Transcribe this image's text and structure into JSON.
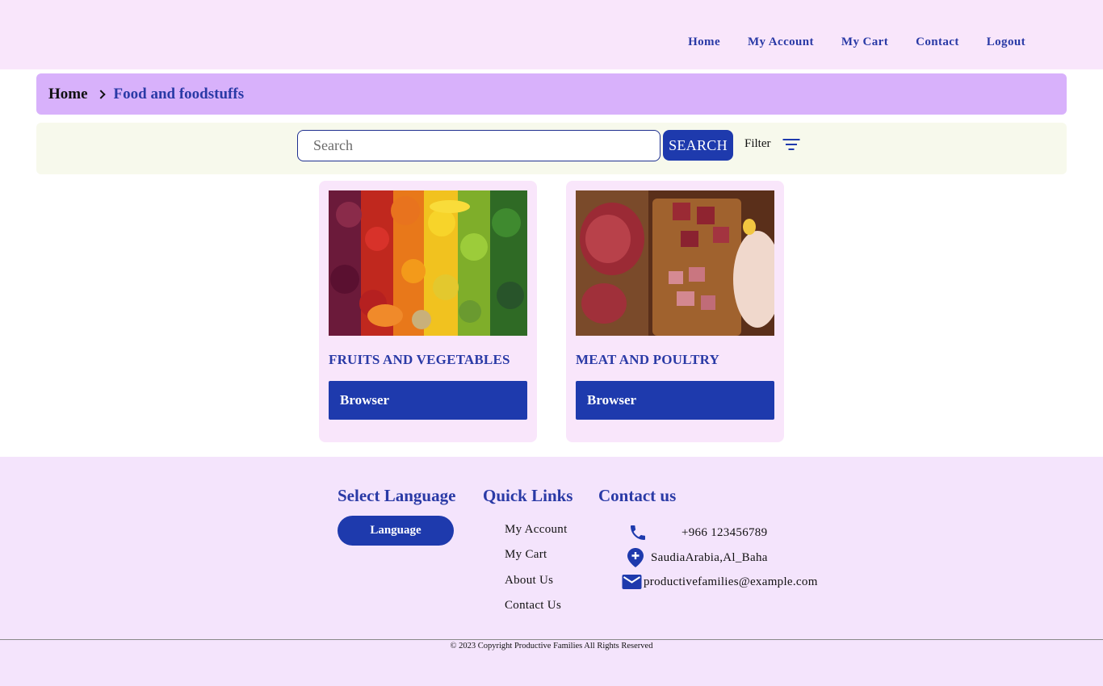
{
  "nav": {
    "items": [
      "Home",
      "My Account",
      "My Cart",
      "Contact",
      "Logout"
    ]
  },
  "breadcrumb": {
    "home": "Home",
    "current": "Food and foodstuffs"
  },
  "search": {
    "placeholder": "Search",
    "value": "",
    "button_label": "SEARCH",
    "filter_label": "Filter"
  },
  "categories": [
    {
      "title": "FRUITS AND VEGETABLES",
      "button_label": "Browser",
      "image": "fruits-vegetables-photo"
    },
    {
      "title": "MEAT AND POULTRY",
      "button_label": "Browser",
      "image": "meat-poultry-photo"
    }
  ],
  "footer": {
    "language": {
      "title": "Select Language",
      "button_label": "Language"
    },
    "quick_links": {
      "title": "Quick Links",
      "items": [
        "My Account",
        "My Cart",
        "About Us",
        "Contact Us"
      ]
    },
    "contact": {
      "title": "Contact us",
      "phone": "+966 123456789",
      "location": "SaudiaArabia,Al_Baha",
      "email": "productivefamilies@example.com"
    },
    "copyright": "© 2023 Copyright Productive Families All Rights Reserved"
  },
  "colors": {
    "header_bg": "#f9e6fb",
    "breadcrumb_bg": "#d8b1fb",
    "accent": "#1e3aad",
    "link": "#2a3aa6",
    "footer_bg": "#f4e4fc"
  }
}
